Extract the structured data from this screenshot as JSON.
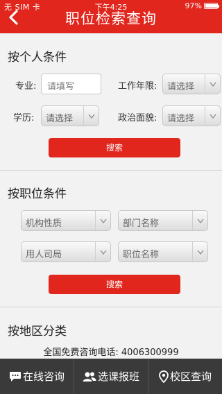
{
  "statusbar": {
    "carrier": "无 SIM 卡",
    "time": "下午4:25",
    "battery": "97%",
    "battery_level": 0.97
  },
  "header": {
    "title": "职位检索查询"
  },
  "personal": {
    "title": "按个人条件",
    "major_label": "专业:",
    "major_placeholder": "请填写",
    "years_label": "工作年限:",
    "years_value": "请选择",
    "edu_label": "学历:",
    "edu_value": "请选择",
    "political_label": "政治面貌:",
    "political_value": "请选择",
    "search_label": "搜索"
  },
  "position": {
    "title": "按职位条件",
    "org_type": "机构性质",
    "dept_name": "部门名称",
    "employer": "用人司局",
    "job_name": "职位名称",
    "search_label": "搜索"
  },
  "region": {
    "title": "按地区分类"
  },
  "hotline": "全国免费咨询电话: 4006300999",
  "tabbar": {
    "consult": "在线咨询",
    "enroll": "选课报班",
    "campus": "校区查询"
  }
}
